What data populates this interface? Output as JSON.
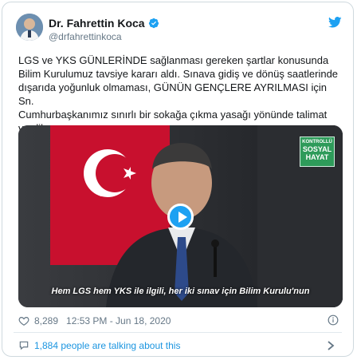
{
  "author": {
    "name": "Dr. Fahrettin Koca",
    "handle": "@drfahrettinkoca",
    "verified_icon": "verified-badge-icon",
    "avatar": "profile-avatar"
  },
  "brand": {
    "icon": "twitter-bird-icon",
    "color": "#1da1f2"
  },
  "tweet": {
    "text": "LGS ve YKS GÜNLERİNDE sağlanması gereken şartlar konusunda\nBilim Kurulumuz tavsiye kararı aldı. Sınava gidiş ve dönüş saatlerinde\ndışarıda yoğunluk olmaması, GÜNÜN GENÇLERE AYRILMASI için Sn.\nCumhurbaşkanımız sınırlı bir sokağa çıkma yasağı yönünde talimat\nverdiler."
  },
  "video": {
    "badge_line1": "KONTROLLÜ",
    "badge_line2": "SOSYAL",
    "badge_line3": "HAYAT",
    "caption": "Hem LGS hem YKS ile ilgili, her iki sınav için Bilim Kurulu'nun",
    "play_icon": "play-icon"
  },
  "meta": {
    "likes": "8,289",
    "timestamp": "12:53 PM - Jun 18, 2020"
  },
  "talking": {
    "label": "1,884 people are talking about this"
  }
}
